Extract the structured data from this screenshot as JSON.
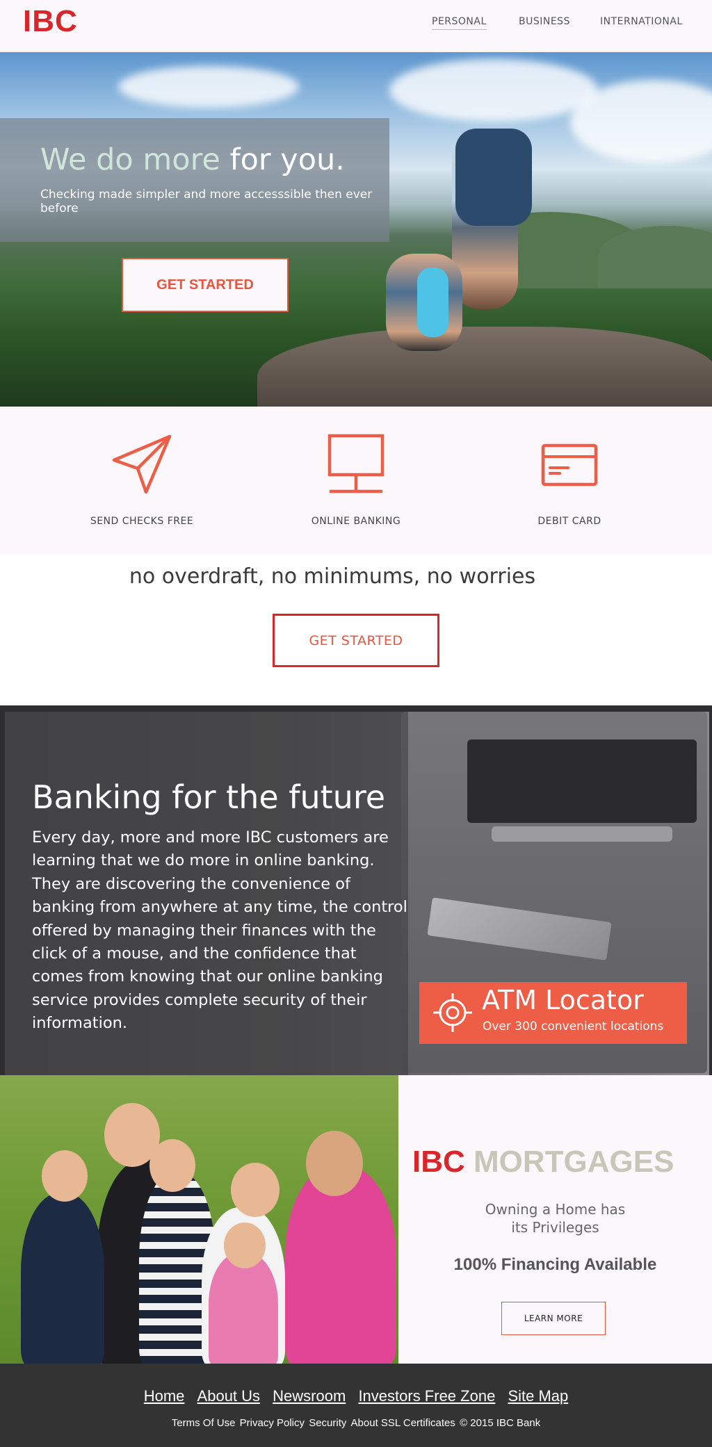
{
  "header": {
    "logo": "IBC",
    "nav": [
      "PERSONAL",
      "BUSINESS",
      "INTERNATIONAL"
    ]
  },
  "hero": {
    "title_accent": "We do more",
    "title_rest": " for you.",
    "subtitle": "Checking made simpler and more accesssible then ever before",
    "button": "GET STARTED"
  },
  "features": [
    {
      "icon": "paper-plane-icon",
      "label": "SEND CHECKS FREE"
    },
    {
      "icon": "monitor-icon",
      "label": "ONLINE BANKING"
    },
    {
      "icon": "credit-card-icon",
      "label": "DEBIT CARD"
    }
  ],
  "tagline": {
    "text": "no overdraft, no minimums, no worries",
    "button": "GET STARTED"
  },
  "banking": {
    "title": "Banking for the future",
    "body": "Every day, more and more IBC customers are learning that we do more in online banking. They are discovering the convenience of banking from anywhere at any time, the control offered by managing their finances with the click of a mouse, and the confidence that comes from knowing that our online banking service provides complete security of their information.",
    "atm": {
      "icon": "crosshair-icon",
      "title": "ATM Locator",
      "subtitle": "Over 300 convenient locations"
    }
  },
  "mortgage": {
    "brand_ibc": "IBC",
    "brand_word": "MORTGAGES",
    "line1": "Owning a Home has",
    "line2": "its Privileges",
    "financing": "100% Financing Available",
    "button": "LEARN MORE"
  },
  "footer": {
    "links": [
      "Home",
      "About Us",
      "Newsroom",
      "Investors Free Zone",
      "Site Map"
    ],
    "legal": [
      "Terms Of Use",
      "Privacy Policy",
      "Security",
      "About SSL Certificates",
      "© 2015 IBC Bank"
    ]
  },
  "colors": {
    "brand_red": "#d9262b",
    "accent_orange": "#ee5e47",
    "footer_bg": "#333333"
  }
}
